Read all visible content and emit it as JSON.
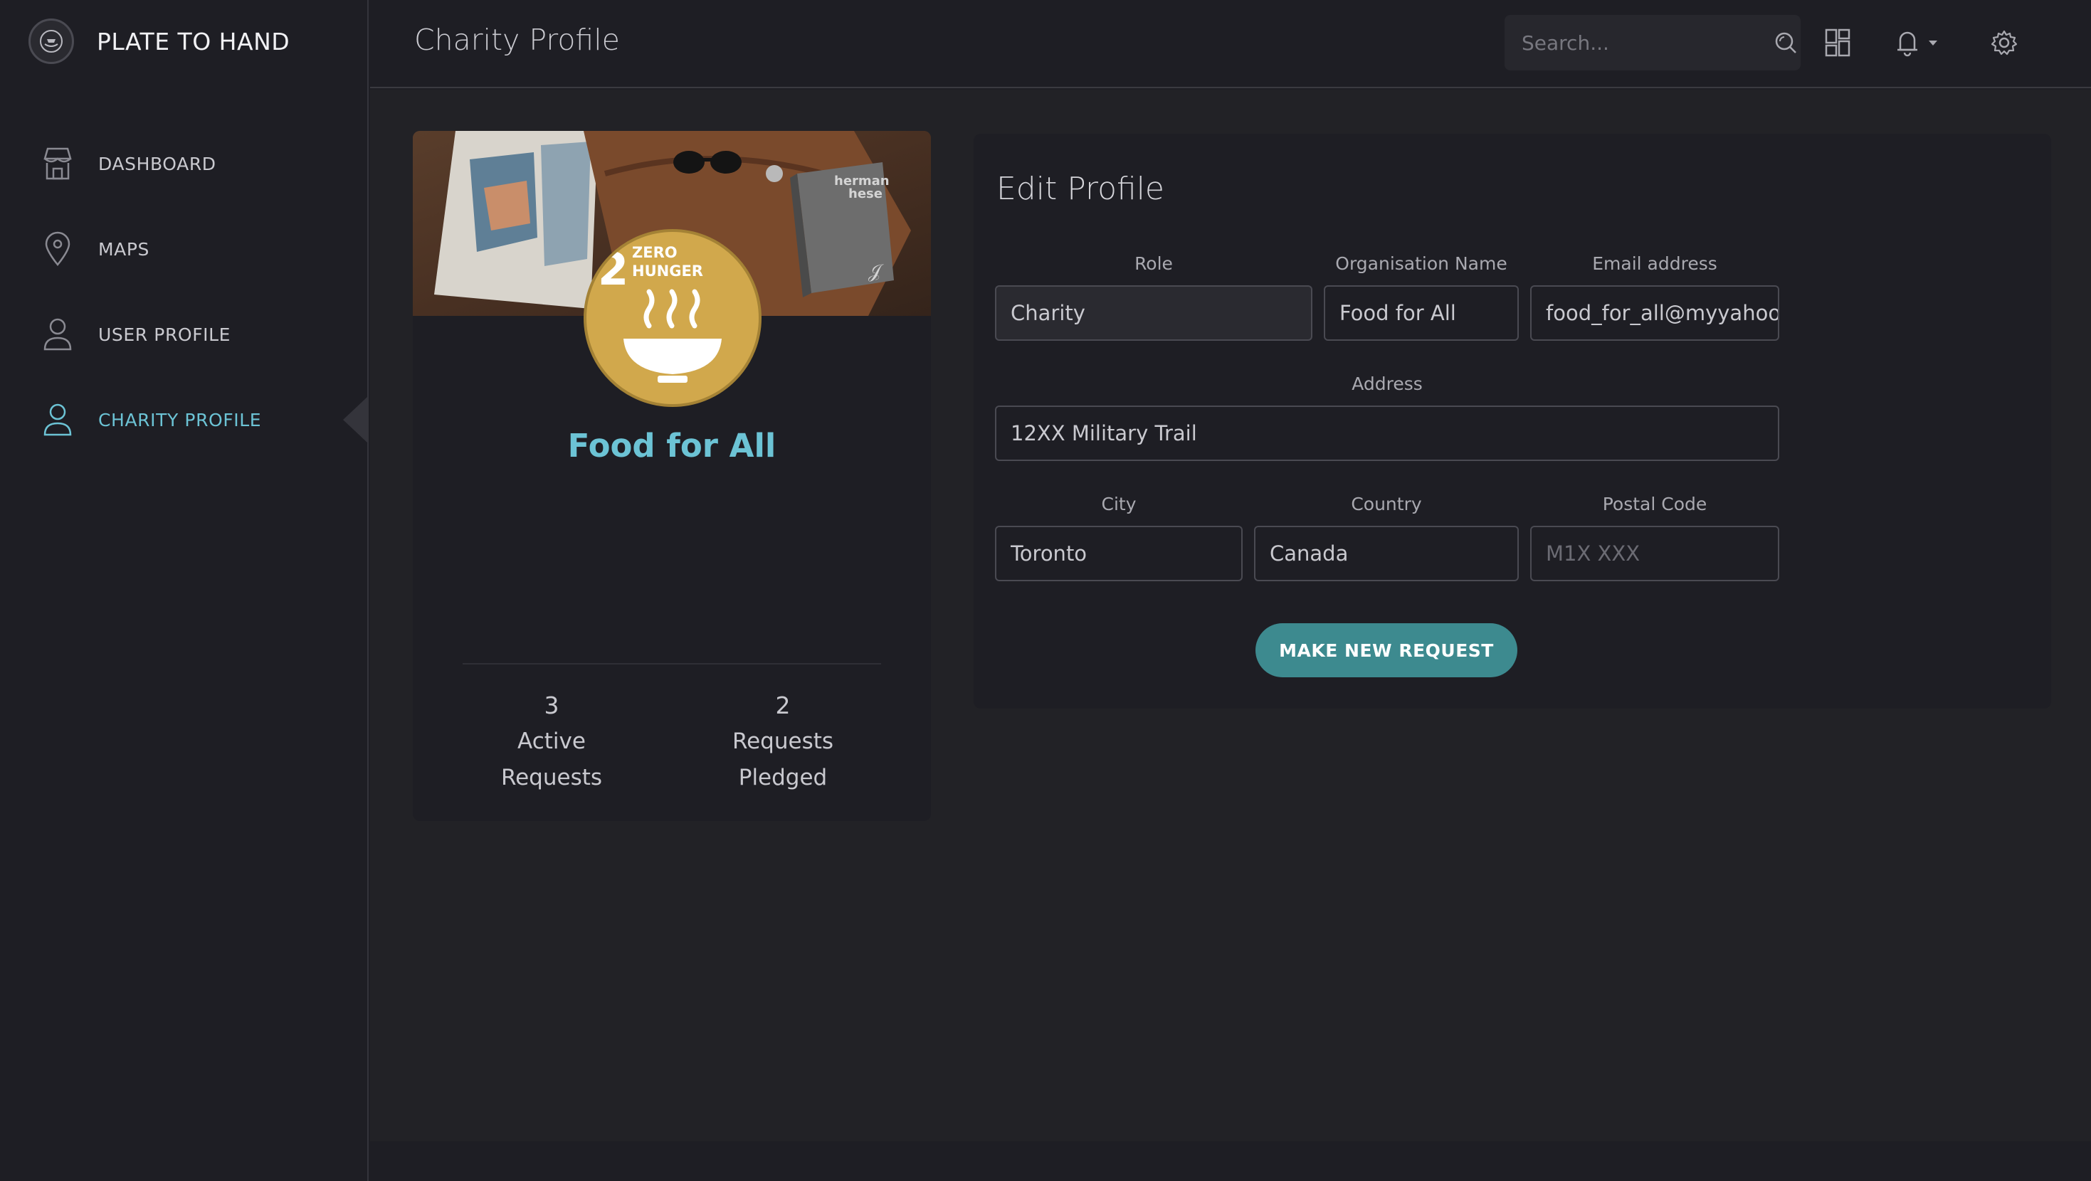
{
  "brand": {
    "title": "PLATE TO HAND"
  },
  "sidebar": {
    "items": [
      {
        "label": "DASHBOARD",
        "icon": "store-icon"
      },
      {
        "label": "MAPS",
        "icon": "map-pin-icon"
      },
      {
        "label": "USER PROFILE",
        "icon": "user-icon"
      },
      {
        "label": "CHARITY PROFILE",
        "icon": "user-icon",
        "active": true
      }
    ]
  },
  "header": {
    "title": "Charity Profile",
    "search_placeholder": "Search..."
  },
  "profile_card": {
    "org_name": "Food for All",
    "badge": {
      "number": "2",
      "line1": "ZERO",
      "line2": "HUNGER"
    },
    "cover_book": {
      "line1": "herman",
      "line2": "hese"
    },
    "stats": [
      {
        "value": "3",
        "line1": "Active",
        "line2": "Requests"
      },
      {
        "value": "2",
        "line1": "Requests",
        "line2": "Pledged"
      }
    ]
  },
  "edit_profile": {
    "title": "Edit Profile",
    "fields": {
      "role": {
        "label": "Role",
        "value": "Charity"
      },
      "org_name": {
        "label": "Organisation Name",
        "value": "Food for All"
      },
      "email": {
        "label": "Email address",
        "value": "food_for_all@myyahoo.com"
      },
      "address": {
        "label": "Address",
        "value": "12XX Military Trail"
      },
      "city": {
        "label": "City",
        "value": "Toronto"
      },
      "country": {
        "label": "Country",
        "value": "Canada"
      },
      "postal": {
        "label": "Postal Code",
        "value": "",
        "placeholder": "M1X XXX"
      }
    },
    "button_label": "MAKE NEW REQUEST"
  },
  "colors": {
    "accent": "#6cc3d5",
    "button": "#3d8a8f",
    "badge": "#d1a84c"
  }
}
